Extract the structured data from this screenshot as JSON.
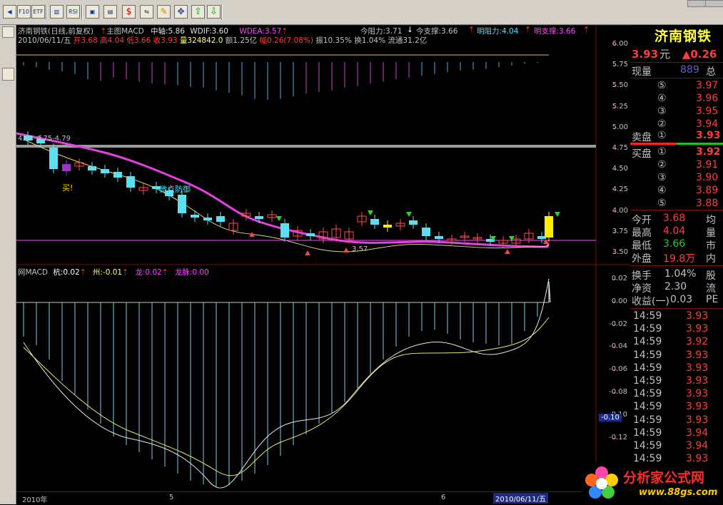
{
  "toolbar": {
    "buttons": [
      "first-icon",
      "f10-icon",
      "etf-icon",
      "bar-chart-icon",
      "rsi-icon",
      "window-icon",
      "chart-icon",
      "dollar-icon",
      "link-icon",
      "pencil-icon",
      "move-icon",
      "arrow-up-icon",
      "arrow-down-icon"
    ],
    "btn_labels": [
      "◀",
      "F10",
      "ETF",
      "▥",
      "RSI",
      "▣",
      "▤",
      "$",
      "⇆",
      "✎",
      "✥",
      "⇧",
      "⇩"
    ]
  },
  "main_header": {
    "stock": "济南钢铁(日线,前复权)",
    "main_label": "主图MACD",
    "zhongzhou": "中轴:5.86",
    "wdif": "WDIF:3.60",
    "wdea": "WDEA:3.57",
    "zuli": "今阻力:3.71",
    "zhicheng": "今支撑:3.66",
    "mingzuli": "明阻力:4.04",
    "mingzhicheng": "明支撑:3.66",
    "date": "2010/06/11/五",
    "open": "开3.68",
    "high": "高4.04",
    "low": "低3.66",
    "close": "收3.93",
    "volume": "量324842.0",
    "amount": "额1.25亿",
    "change": "幅0.26(7.08%)",
    "amplitude": "振10.35%",
    "turnover": "换1.04%",
    "float": "流通31.2亿"
  },
  "price_axis": [
    "6.00",
    "5.75",
    "5.50",
    "5.25",
    "5.00",
    "4.75",
    "4.50",
    "4.25",
    "4.00",
    "3.75",
    "3.50"
  ],
  "macd_axis": [
    "0.02",
    "0.00",
    "-0.02",
    "-0.04",
    "-0.06",
    "-0.08",
    "-0.10",
    "-0.12"
  ],
  "indicator_header": {
    "name": "网MACD",
    "kang": "杭:0.02",
    "zhou": "州:-0.01",
    "long": "龙:0.02",
    "longji": "龙脉:0.00"
  },
  "annotations": {
    "level": "4.94-4.75-4.79",
    "buy": "买",
    "buy_mark": "!",
    "weak": "微点防御",
    "low": "3.57"
  },
  "date_bar": {
    "year": "2010年",
    "m5": "5",
    "m6": "6",
    "current": "2010/06/11/五"
  },
  "right_panel": {
    "name": "济南钢铁",
    "price": "3.93",
    "price_unit": "元",
    "change": "▲0.26",
    "xianliang_label": "现量",
    "xianliang": "889",
    "zong": "总",
    "sell_label": "卖盘",
    "buy_label": "买盘",
    "asks": [
      {
        "n": "⑤",
        "p": "3.97"
      },
      {
        "n": "④",
        "p": "3.96"
      },
      {
        "n": "③",
        "p": "3.95"
      },
      {
        "n": "②",
        "p": "3.94"
      }
    ],
    "ask1": {
      "n": "①",
      "p": "3.93"
    },
    "bid1": {
      "n": "①",
      "p": "3.92"
    },
    "bids": [
      {
        "n": "②",
        "p": "3.91"
      },
      {
        "n": "③",
        "p": "3.90"
      },
      {
        "n": "④",
        "p": "3.89"
      },
      {
        "n": "⑤",
        "p": "3.88"
      }
    ],
    "stats": [
      {
        "l": "今开",
        "v": "3.68",
        "r": "均"
      },
      {
        "l": "最高",
        "v": "4.04",
        "r": "量"
      },
      {
        "l": "最低",
        "v": "3.66",
        "r": "市"
      },
      {
        "l": "外盘",
        "v": "19.8万",
        "r": "内"
      }
    ],
    "fin": [
      {
        "l": "换手",
        "v": "1.04%",
        "r": "股"
      },
      {
        "l": "净资",
        "v": "2.30",
        "r": "流"
      },
      {
        "l": "收益(一)",
        "v": "0.03",
        "r": "PE"
      }
    ],
    "ticks": [
      {
        "t": "14:59",
        "p": "3.93"
      },
      {
        "t": "14:59",
        "p": "3.93"
      },
      {
        "t": "14:59",
        "p": "3.92"
      },
      {
        "t": "14:59",
        "p": "3.93"
      },
      {
        "t": "14:59",
        "p": "3.93"
      },
      {
        "t": "14:59",
        "p": "3.93"
      },
      {
        "t": "14:59",
        "p": "3.93"
      },
      {
        "t": "14:59",
        "p": "3.93"
      },
      {
        "t": "14:59",
        "p": "3.93"
      },
      {
        "t": "14:59",
        "p": "3.94"
      },
      {
        "t": "14:59",
        "p": "3.94"
      },
      {
        "t": "14:59",
        "p": "3.93"
      }
    ]
  },
  "macd_marker": "-0.10",
  "logo": {
    "title": "分析家公式网",
    "url": "www.88gs.com"
  }
}
